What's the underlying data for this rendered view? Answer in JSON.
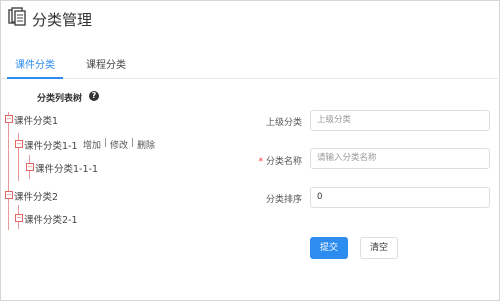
{
  "page": {
    "title": "分类管理",
    "icon": "document-stack-icon"
  },
  "tabs": [
    {
      "label": "课件分类",
      "active": true
    },
    {
      "label": "课程分类",
      "active": false
    }
  ],
  "tree": {
    "heading": "分类列表树",
    "help_icon": "?",
    "nodes": {
      "n1": "课件分类1",
      "n1_1": "课件分类1-1",
      "n1_1_1": "课件分类1-1-1",
      "n2": "课件分类2",
      "n2_1": "课件分类2-1"
    },
    "actions": {
      "add": "增加",
      "edit": "修改",
      "delete": "删除",
      "separator": "|"
    },
    "toggle_symbol": "−"
  },
  "form": {
    "parent": {
      "label": "上级分类",
      "placeholder": "上级分类",
      "value": ""
    },
    "name": {
      "required_mark": "*",
      "label": "分类名称",
      "placeholder": "请输入分类名称",
      "value": ""
    },
    "order": {
      "label": "分类排序",
      "value": "0"
    },
    "submit_label": "提交",
    "clear_label": "清空"
  },
  "colors": {
    "accent": "#2d8cf0",
    "tree_line": "#e89a9a"
  }
}
